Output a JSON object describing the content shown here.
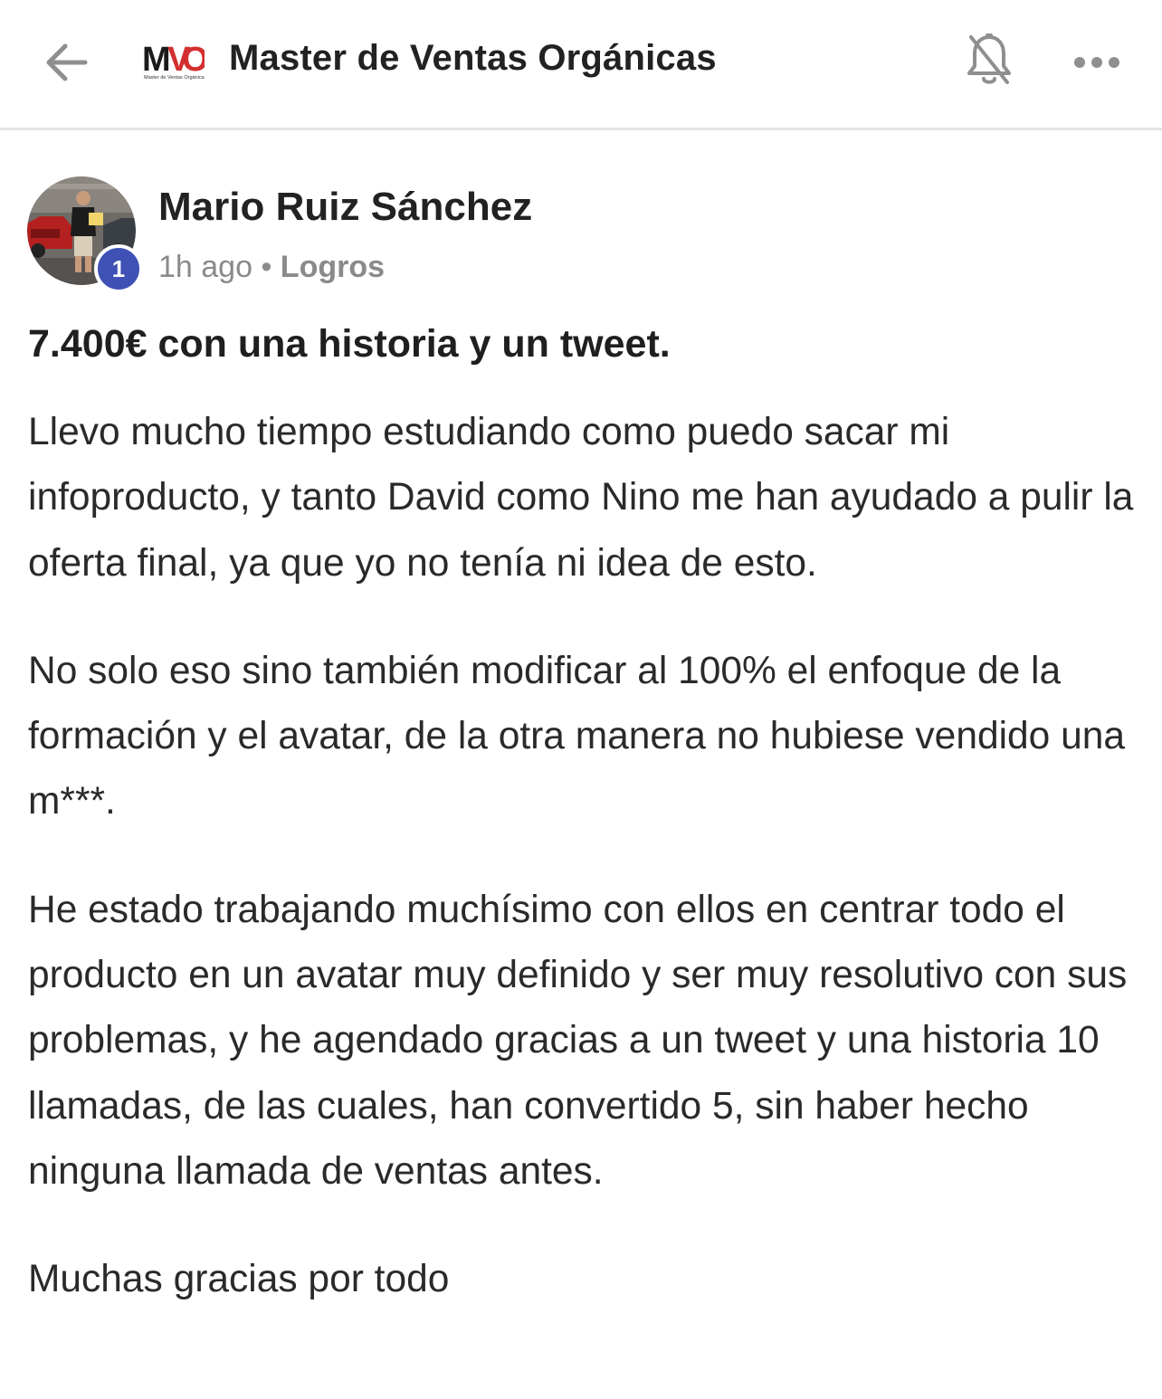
{
  "header": {
    "back_icon": "arrow-left-icon",
    "logo_text": "MVO",
    "logo_subtext": "Master de Ventas Orgánicas",
    "group_title": "Master de Ventas Orgánicas",
    "bell_icon": "bell-icon",
    "more_icon": "more-horizontal-icon"
  },
  "post": {
    "author": "Mario Ruiz Sánchez",
    "level": "1",
    "time": "1h ago",
    "separator": " • ",
    "category": "Logros",
    "title": "7.400€ con una historia y un tweet.",
    "paragraphs": [
      "Llevo mucho tiempo estudiando como puedo sacar mi infoproducto, y tanto David como Nino me han ayudado a pulir la oferta final, ya que yo no tenía ni idea de esto.",
      "No solo eso sino también modificar al 100% el enfoque de la formación y el avatar, de la otra manera no hubiese vendido una m***.",
      "He estado trabajando muchísimo con ellos en centrar todo el producto en un avatar muy definido y ser muy resolutivo con sus problemas, y he agendado gracias a un tweet y una historia 10 llamadas, de las cuales, han convertido 5, sin haber hecho ninguna llamada de ventas antes.",
      "Muchas gracias por todo"
    ]
  },
  "colors": {
    "badge": "#3f51b5",
    "logo_red": "#d32f2f",
    "icon_gray": "#8f8f8f",
    "meta_gray": "#8a8a8a",
    "divider": "#e4e4e4"
  }
}
